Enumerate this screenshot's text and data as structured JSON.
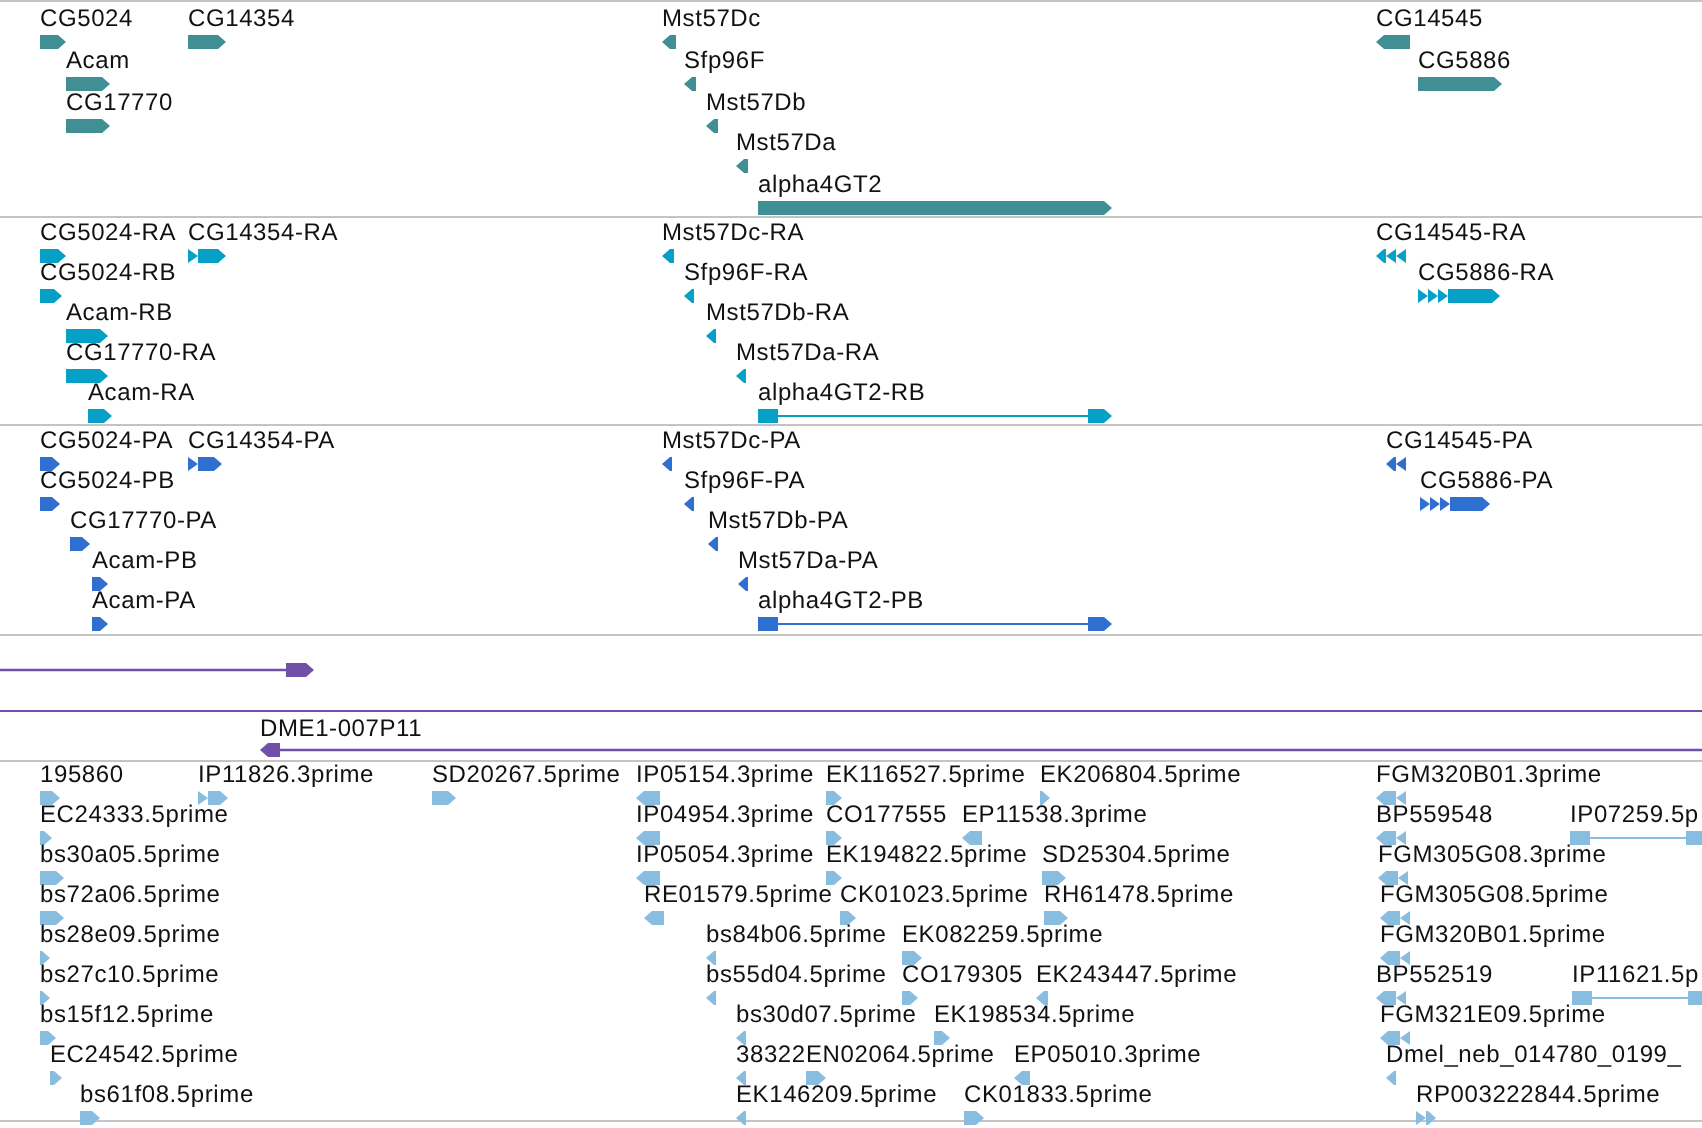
{
  "tracks": [
    {
      "kind": "features",
      "color": "#3f8f94",
      "features": [
        {
          "label": "CG5024",
          "reverse": false
        },
        {
          "label": "CG14354",
          "reverse": false
        },
        {
          "label": "Acam",
          "reverse": false
        },
        {
          "label": "CG17770",
          "reverse": false
        },
        {
          "label": "Mst57Dc",
          "reverse": true
        },
        {
          "label": "Sfp96F",
          "reverse": true
        },
        {
          "label": "Mst57Db",
          "reverse": true
        },
        {
          "label": "Mst57Da",
          "reverse": true
        },
        {
          "label": "alpha4GT2",
          "reverse": false
        },
        {
          "label": "CG14545",
          "reverse": true
        },
        {
          "label": "CG5886",
          "reverse": false
        }
      ]
    },
    {
      "kind": "features",
      "color": "#06a0c6",
      "features": [
        {
          "label": "CG5024-RA",
          "reverse": false
        },
        {
          "label": "CG14354-RA",
          "reverse": false
        },
        {
          "label": "CG5024-RB",
          "reverse": false
        },
        {
          "label": "Acam-RB",
          "reverse": false
        },
        {
          "label": "CG17770-RA",
          "reverse": false
        },
        {
          "label": "Acam-RA",
          "reverse": false
        },
        {
          "label": "Mst57Dc-RA",
          "reverse": true
        },
        {
          "label": "Sfp96F-RA",
          "reverse": true
        },
        {
          "label": "Mst57Db-RA",
          "reverse": true
        },
        {
          "label": "Mst57Da-RA",
          "reverse": true
        },
        {
          "label": "alpha4GT2-RB",
          "reverse": false
        },
        {
          "label": "CG14545-RA",
          "reverse": true
        },
        {
          "label": "CG5886-RA",
          "reverse": false
        }
      ]
    },
    {
      "kind": "features",
      "color": "#2f6fd0",
      "features": [
        {
          "label": "CG5024-PA",
          "reverse": false
        },
        {
          "label": "CG14354-PA",
          "reverse": false
        },
        {
          "label": "CG5024-PB",
          "reverse": false
        },
        {
          "label": "CG17770-PA",
          "reverse": false
        },
        {
          "label": "Acam-PB",
          "reverse": false
        },
        {
          "label": "Acam-PA",
          "reverse": false
        },
        {
          "label": "Mst57Dc-PA",
          "reverse": true
        },
        {
          "label": "Sfp96F-PA",
          "reverse": true
        },
        {
          "label": "Mst57Db-PA",
          "reverse": true
        },
        {
          "label": "Mst57Da-PA",
          "reverse": true
        },
        {
          "label": "alpha4GT2-PB",
          "reverse": false
        },
        {
          "label": "CG14545-PA",
          "reverse": true
        },
        {
          "label": "CG5886-PA",
          "reverse": false
        }
      ]
    },
    {
      "kind": "line",
      "color": "#7050a8",
      "reverse": false
    },
    {
      "kind": "labeled_line",
      "color": "#7050a8",
      "label": "DME1-007P11",
      "reverse": true
    },
    {
      "kind": "features",
      "color": "#88bde0",
      "features": [
        {
          "label": "195860",
          "reverse": false
        },
        {
          "label": "IP11826.3prime",
          "reverse": false
        },
        {
          "label": "SD20267.5prime",
          "reverse": false
        },
        {
          "label": "IP05154.3prime",
          "reverse": true
        },
        {
          "label": "EK116527.5prime",
          "reverse": false
        },
        {
          "label": "EK206804.5prime",
          "reverse": false
        },
        {
          "label": "FGM320B01.3prime",
          "reverse": true
        },
        {
          "label": "EC24333.5prime",
          "reverse": false
        },
        {
          "label": "IP04954.3prime",
          "reverse": true
        },
        {
          "label": "CO177555",
          "reverse": false
        },
        {
          "label": "EP11538.3prime",
          "reverse": true
        },
        {
          "label": "BP559548",
          "reverse": true
        },
        {
          "label": "IP07259.5p",
          "reverse": false
        },
        {
          "label": "bs30a05.5prime",
          "reverse": false
        },
        {
          "label": "IP05054.3prime",
          "reverse": true
        },
        {
          "label": "EK194822.5prime",
          "reverse": false
        },
        {
          "label": "SD25304.5prime",
          "reverse": false
        },
        {
          "label": "FGM305G08.3prime",
          "reverse": true
        },
        {
          "label": "bs72a06.5prime",
          "reverse": false
        },
        {
          "label": "RE01579.5prime",
          "reverse": true
        },
        {
          "label": "CK01023.5prime",
          "reverse": false
        },
        {
          "label": "RH61478.5prime",
          "reverse": false
        },
        {
          "label": "FGM305G08.5prime",
          "reverse": true
        },
        {
          "label": "bs28e09.5prime",
          "reverse": false
        },
        {
          "label": "bs84b06.5prime",
          "reverse": true
        },
        {
          "label": "EK082259.5prime",
          "reverse": false
        },
        {
          "label": "FGM320B01.5prime",
          "reverse": true
        },
        {
          "label": "bs27c10.5prime",
          "reverse": false
        },
        {
          "label": "bs55d04.5prime",
          "reverse": true
        },
        {
          "label": "CO179305",
          "reverse": false
        },
        {
          "label": "EK243447.5prime",
          "reverse": true
        },
        {
          "label": "BP552519",
          "reverse": true
        },
        {
          "label": "IP11621.5p",
          "reverse": false
        },
        {
          "label": "bs15f12.5prime",
          "reverse": false
        },
        {
          "label": "bs30d07.5prime",
          "reverse": true
        },
        {
          "label": "EK198534.5prime",
          "reverse": false
        },
        {
          "label": "FGM321E09.5prime",
          "reverse": true
        },
        {
          "label": "EC24542.5prime",
          "reverse": false
        },
        {
          "label": "38322",
          "reverse": true
        },
        {
          "label": "EN02064.5prime",
          "reverse": false
        },
        {
          "label": "EP05010.3prime",
          "reverse": true
        },
        {
          "label": "Dmel_neb_014780_0199_",
          "reverse": true
        },
        {
          "label": "bs61f08.5prime",
          "reverse": false
        },
        {
          "label": "EK146209.5prime",
          "reverse": true
        },
        {
          "label": "CK01833.5prime",
          "reverse": false
        },
        {
          "label": "RP003222844.5prime",
          "reverse": false
        }
      ]
    }
  ]
}
